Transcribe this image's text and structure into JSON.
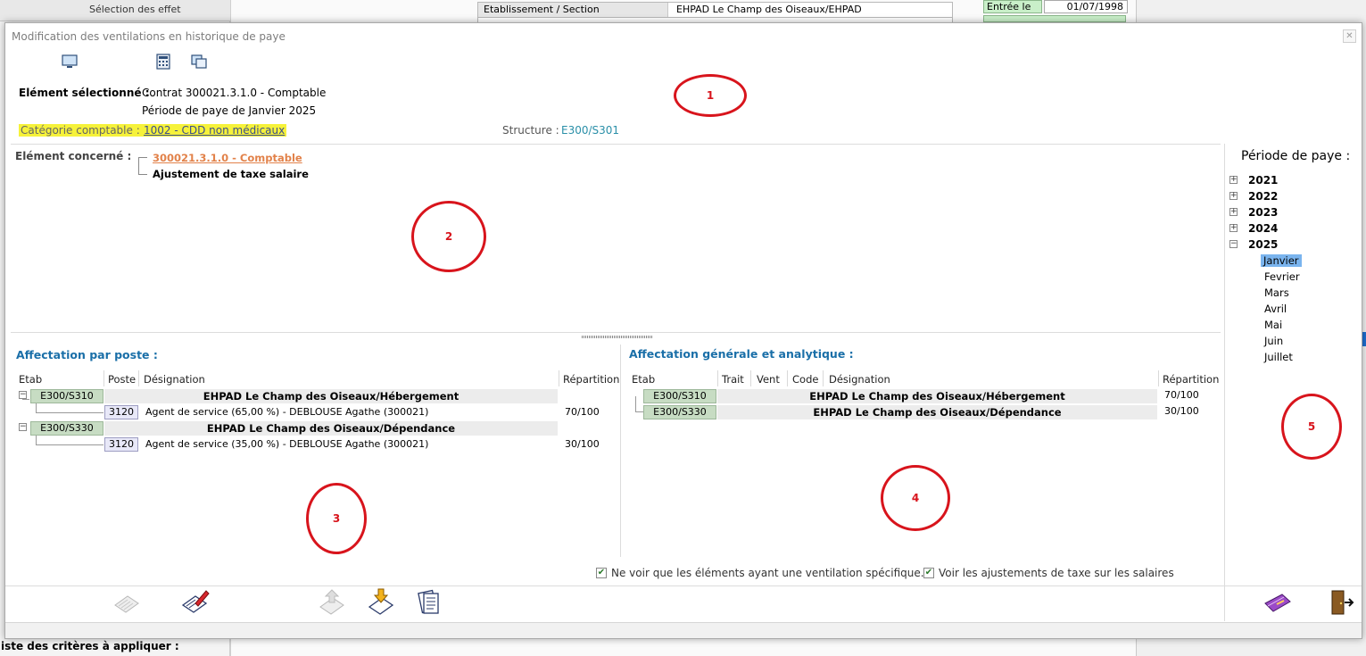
{
  "background": {
    "left_panel_text": "Sélection des  effet",
    "row_label": "Etablissement / Section",
    "row_value": "EHPAD Le Champ des Oiseaux/EHPAD",
    "entry_label": "Entrée le",
    "entry_value": "01/07/1998",
    "criteria_label": "iste des critères à appliquer :"
  },
  "dialog": {
    "title": "Modification des ventilations en historique de paye",
    "toolbar_icons": [
      "monitor-icon",
      "calculator-icon",
      "windows-icon"
    ]
  },
  "header": {
    "selected_label": "Elément sélectionné :",
    "selected_value": "Contrat 300021.3.1.0 - Comptable",
    "period_value": "Période de paye de Janvier 2025",
    "category_label": "Catégorie comptable :",
    "category_value": "1002 - CDD non médicaux",
    "structure_label": "Structure :",
    "structure_value": "E300/S301"
  },
  "element": {
    "label": "Elément concerné :",
    "link": "300021.3.1.0 - Comptable",
    "sub": "Ajustement de taxe salaire"
  },
  "annotations": [
    "1",
    "2",
    "3",
    "4",
    "5"
  ],
  "poste": {
    "title": "Affectation par poste :",
    "headers": [
      "Etab",
      "Poste",
      "Désignation",
      "Répartition"
    ],
    "groups": [
      {
        "etab": "E300/S310",
        "name": "EHPAD Le Champ des Oiseaux/Hébergement",
        "poste": "3120",
        "designation": "Agent de service (65,00 %) - DEBLOUSE Agathe (300021)",
        "repartition": "70/100"
      },
      {
        "etab": "E300/S330",
        "name": "EHPAD Le Champ des Oiseaux/Dépendance",
        "poste": "3120",
        "designation": "Agent de service (35,00 %) - DEBLOUSE Agathe (300021)",
        "repartition": "30/100"
      }
    ]
  },
  "general": {
    "title": "Affectation générale et analytique :",
    "headers": [
      "Etab",
      "Trait",
      "Vent",
      "Code",
      "Désignation",
      "Répartition"
    ],
    "rows": [
      {
        "etab": "E300/S310",
        "designation": "EHPAD Le Champ des Oiseaux/Hébergement",
        "repartition": "70/100"
      },
      {
        "etab": "E300/S330",
        "designation": "EHPAD Le Champ des Oiseaux/Dépendance",
        "repartition": "30/100"
      }
    ]
  },
  "periods": {
    "title": "Période de paye :",
    "years": [
      "2021",
      "2022",
      "2023",
      "2024",
      "2025"
    ],
    "months": [
      "Janvier",
      "Fevrier",
      "Mars",
      "Avril",
      "Mai",
      "Juin",
      "Juillet"
    ],
    "selected_month": "Janvier"
  },
  "options": {
    "only_specific": "Ne voir que les éléments ayant une ventilation spécifique.",
    "show_tax": "Voir les ajustements de taxe sur les salaires"
  },
  "colors": {
    "accent": "#1a6fa8",
    "highlight": "#f6f23a",
    "annotation": "#d8141c",
    "link": "#e2824a"
  }
}
